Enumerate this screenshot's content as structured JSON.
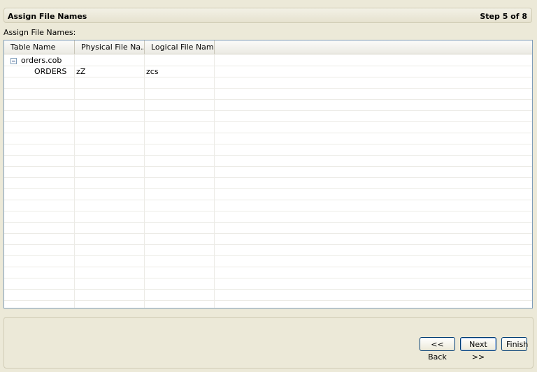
{
  "header": {
    "title": "Assign File Names",
    "step": "Step 5 of 8"
  },
  "section_label": "Assign File Names:",
  "table": {
    "columns": [
      "Table Name",
      "Physical File Na...",
      "Logical File Name"
    ],
    "rows": [
      {
        "type": "group",
        "name": "orders.cob",
        "expanded": true
      },
      {
        "type": "item",
        "name": "ORDERS",
        "physical": "zZ",
        "logical": "zcs"
      }
    ]
  },
  "buttons": {
    "back": "<< Back",
    "next": "Next >>",
    "finish": "Finish"
  },
  "icons": {
    "expander": "tree-collapse-icon"
  }
}
